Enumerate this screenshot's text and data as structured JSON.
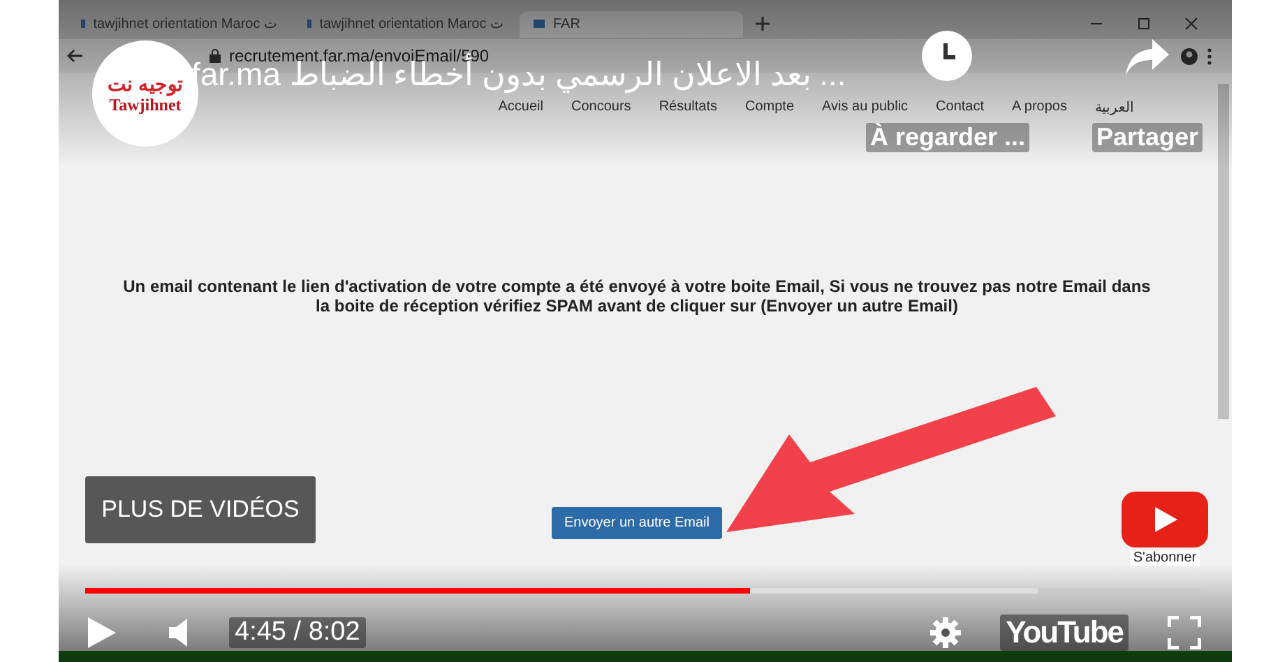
{
  "browser": {
    "tabs": [
      {
        "label": "tawjihnet orientation Maroc ت",
        "selected": false
      },
      {
        "label": "tawjihnet orientation Maroc ت",
        "selected": false
      },
      {
        "label": "FAR",
        "selected": true
      }
    ],
    "url": "recrutement.far.ma/envoiEmail/590"
  },
  "site": {
    "nav": [
      "Accueil",
      "Concours",
      "Résultats",
      "Compte",
      "Avis au public",
      "Contact",
      "A propos",
      "العربية"
    ],
    "message": "Un email contenant le lien d'activation de votre compte a été envoyé à votre boite Email, Si vous ne trouvez pas notre Email dans la boite de réception vérifiez SPAM avant de cliquer sur (Envoyer un autre Email)",
    "button": "Envoyer un autre Email"
  },
  "player": {
    "channel_logo_arabic": "توجيه نت",
    "channel_logo": "Tawjihnet",
    "title": "far.ma بعد الاعلان الرسمي بدون أخطاء الضباط ...",
    "watch_later": "À regarder ...",
    "share": "Partager",
    "more_videos": "PLUS DE VIDÉOS",
    "subscribe": "S'abonner",
    "progress": {
      "level": 0.596
    },
    "buffered": {
      "level": 0.853
    },
    "time": "4:45 / 8:02",
    "brand": "YouTube"
  }
}
